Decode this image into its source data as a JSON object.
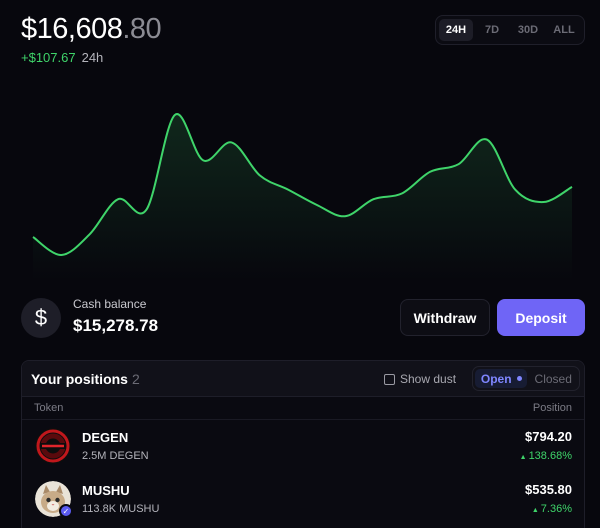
{
  "header": {
    "balance_main": "$16,608",
    "balance_cents": ".80",
    "change_value": "+$107.67",
    "change_period": "24h"
  },
  "range_tabs": [
    {
      "label": "24H",
      "active": true
    },
    {
      "label": "7D",
      "active": false
    },
    {
      "label": "30D",
      "active": false
    },
    {
      "label": "ALL",
      "active": false
    }
  ],
  "chart_data": {
    "type": "line",
    "title": "",
    "xlabel": "",
    "ylabel": "",
    "color": "#3fd46a",
    "series": [
      {
        "values": [
          16555,
          16536,
          16558,
          16595,
          16584,
          16684,
          16636,
          16655,
          16620,
          16605,
          16589,
          16577,
          16595,
          16601,
          16624,
          16632,
          16658,
          16605,
          16592,
          16608
        ]
      }
    ]
  },
  "cash": {
    "icon": "dollar-icon",
    "label": "Cash balance",
    "value": "$15,278.78",
    "withdraw_label": "Withdraw",
    "deposit_label": "Deposit"
  },
  "positions": {
    "title": "Your positions",
    "count": "2",
    "dust_label": "Show dust",
    "open_label": "Open",
    "closed_label": "Closed",
    "col_token": "Token",
    "col_position": "Position",
    "rows": [
      {
        "name": "DEGEN",
        "amount": "2.5M DEGEN",
        "value": "$794.20",
        "change": "138.68%",
        "icon": "degen-logo"
      },
      {
        "name": "MUSHU",
        "amount": "113.8K MUSHU",
        "value": "$535.80",
        "change": "7.36%",
        "icon": "mushu-avatar"
      }
    ]
  },
  "colors": {
    "accent": "#6f65f6",
    "positive": "#3fd46a",
    "background": "#07070d"
  }
}
